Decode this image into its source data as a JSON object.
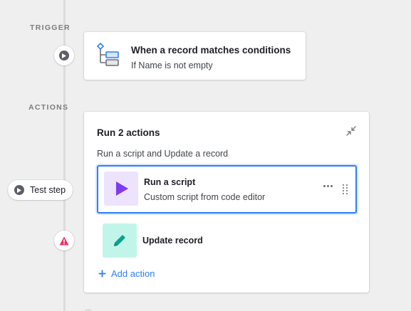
{
  "trigger": {
    "section_label": "TRIGGER",
    "title": "When a record matches conditions",
    "subtitle": "If Name is not empty"
  },
  "actions": {
    "section_label": "ACTIONS",
    "group_title": "Run 2 actions",
    "group_subtitle": "Run a script and Update a record",
    "steps": [
      {
        "title": "Run a script",
        "subtitle": "Custom script from code editor",
        "icon": "play-icon",
        "tile_color": "#ede3fd",
        "icon_color": "#7f3bf0"
      },
      {
        "title": "Update record",
        "icon": "pencil-icon",
        "tile_color": "#c2f5e9",
        "icon_color": "#0ba28f"
      }
    ],
    "add_action_label": "Add action"
  },
  "test_step": {
    "label": "Test step"
  },
  "colors": {
    "accent": "#2d7ff9",
    "warning": "#ef3061"
  }
}
